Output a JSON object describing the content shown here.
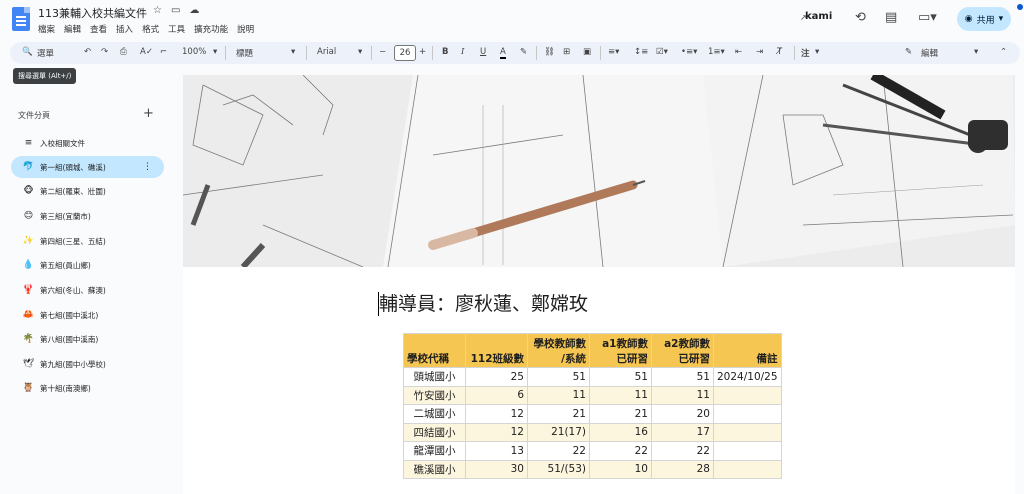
{
  "header": {
    "title": "113兼輔入校共編文件",
    "menus": [
      "檔案",
      "編輯",
      "查看",
      "插入",
      "格式",
      "工具",
      "擴充功能",
      "說明"
    ],
    "kami": "kami",
    "share_label": "共用"
  },
  "toolbar": {
    "search_label": "選單",
    "zoom": "100%",
    "style": "標題",
    "font": "Arial",
    "font_size": "26",
    "bold": "B",
    "italic": "I",
    "underline": "U",
    "textcolor": "A",
    "comment_label": "注",
    "mode": "編輯"
  },
  "tooltip": "搜尋選單 (Alt+/)",
  "outline": {
    "title": "文件分頁",
    "items": [
      {
        "icon": "≡",
        "label": "入校相關文件"
      },
      {
        "icon": "🐬",
        "label": "第一組(頭城、礁溪)"
      },
      {
        "icon": "🐵",
        "label": "第二組(羅東、壯圍)"
      },
      {
        "icon": "😊",
        "label": "第三組(宜蘭市)"
      },
      {
        "icon": "✨",
        "label": "第四組(三星、五結)"
      },
      {
        "icon": "💧",
        "label": "第五組(員山鄉)"
      },
      {
        "icon": "🦞",
        "label": "第六組(冬山、蘇澳)"
      },
      {
        "icon": "🦀",
        "label": "第七組(國中溪北)"
      },
      {
        "icon": "🌴",
        "label": "第八組(國中溪南)"
      },
      {
        "icon": "🕊",
        "label": "第九組(國中小學校)"
      },
      {
        "icon": "🦉",
        "label": "第十組(南澳鄉)"
      }
    ]
  },
  "document": {
    "heading": "輔導員：廖秋蓮、鄭嫦玫",
    "table": {
      "headers": [
        [
          "學校代稱"
        ],
        [
          "112班級數"
        ],
        [
          "學校教師數",
          "/系統"
        ],
        [
          "a1教師數",
          "已研習"
        ],
        [
          "a2教師數",
          "已研習"
        ],
        [
          "備註"
        ]
      ],
      "rows": [
        [
          "頭城國小",
          "25",
          "51",
          "51",
          "51",
          "2024/10/25"
        ],
        [
          "竹安國小",
          "6",
          "11",
          "11",
          "11",
          ""
        ],
        [
          "二城國小",
          "12",
          "21",
          "21",
          "20",
          ""
        ],
        [
          "四結國小",
          "12",
          "21(17)",
          "16",
          "17",
          ""
        ],
        [
          "龍潭國小",
          "13",
          "22",
          "22",
          "22",
          ""
        ],
        [
          "礁溪國小",
          "30",
          "51/(53)",
          "10",
          "28",
          ""
        ]
      ]
    }
  }
}
